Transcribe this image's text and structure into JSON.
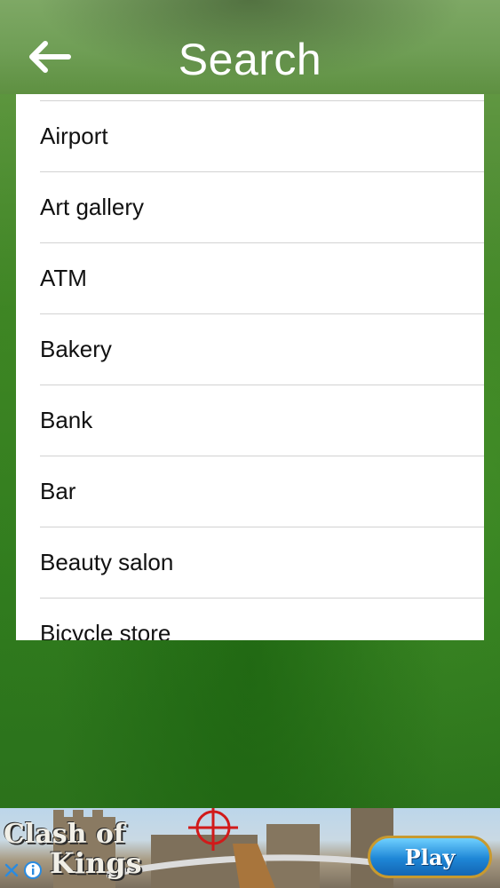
{
  "header": {
    "title": "Search",
    "back_icon": "arrow-left-icon"
  },
  "list": {
    "items": [
      {
        "label": "Airport"
      },
      {
        "label": "Art gallery"
      },
      {
        "label": "ATM"
      },
      {
        "label": "Bakery"
      },
      {
        "label": "Bank"
      },
      {
        "label": "Bar"
      },
      {
        "label": "Beauty salon"
      },
      {
        "label": "Bicycle store"
      }
    ]
  },
  "ad": {
    "logo_line1": "Clash of",
    "logo_line2": "Kings",
    "play_label": "Play",
    "close_icon": "close-icon",
    "info_icon": "info-icon"
  },
  "colors": {
    "header_green": "#6f9e55",
    "background_green": "#3f8326",
    "list_background": "#ffffff",
    "divider": "#d2d2d2",
    "play_button_blue": "#1e86d6",
    "ad_icon_blue": "#2a8be0"
  }
}
